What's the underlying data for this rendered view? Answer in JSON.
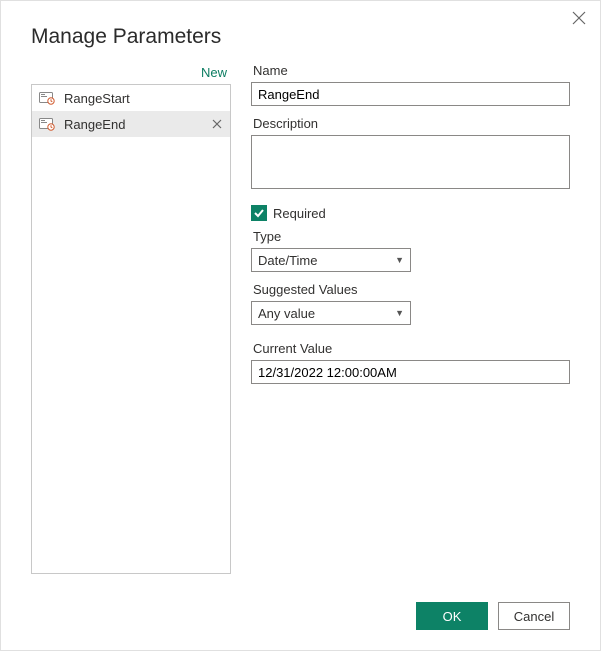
{
  "dialog": {
    "title": "Manage Parameters",
    "new_link": "New"
  },
  "params": {
    "items": [
      {
        "label": "RangeStart"
      },
      {
        "label": "RangeEnd"
      }
    ],
    "selected_index": 1
  },
  "form": {
    "name_label": "Name",
    "name_value": "RangeEnd",
    "description_label": "Description",
    "description_value": "",
    "required_label": "Required",
    "required_checked": true,
    "type_label": "Type",
    "type_value": "Date/Time",
    "suggested_label": "Suggested Values",
    "suggested_value": "Any value",
    "current_label": "Current Value",
    "current_value": "12/31/2022 12:00:00AM"
  },
  "buttons": {
    "ok": "OK",
    "cancel": "Cancel"
  },
  "colors": {
    "accent": "#0d8266"
  }
}
